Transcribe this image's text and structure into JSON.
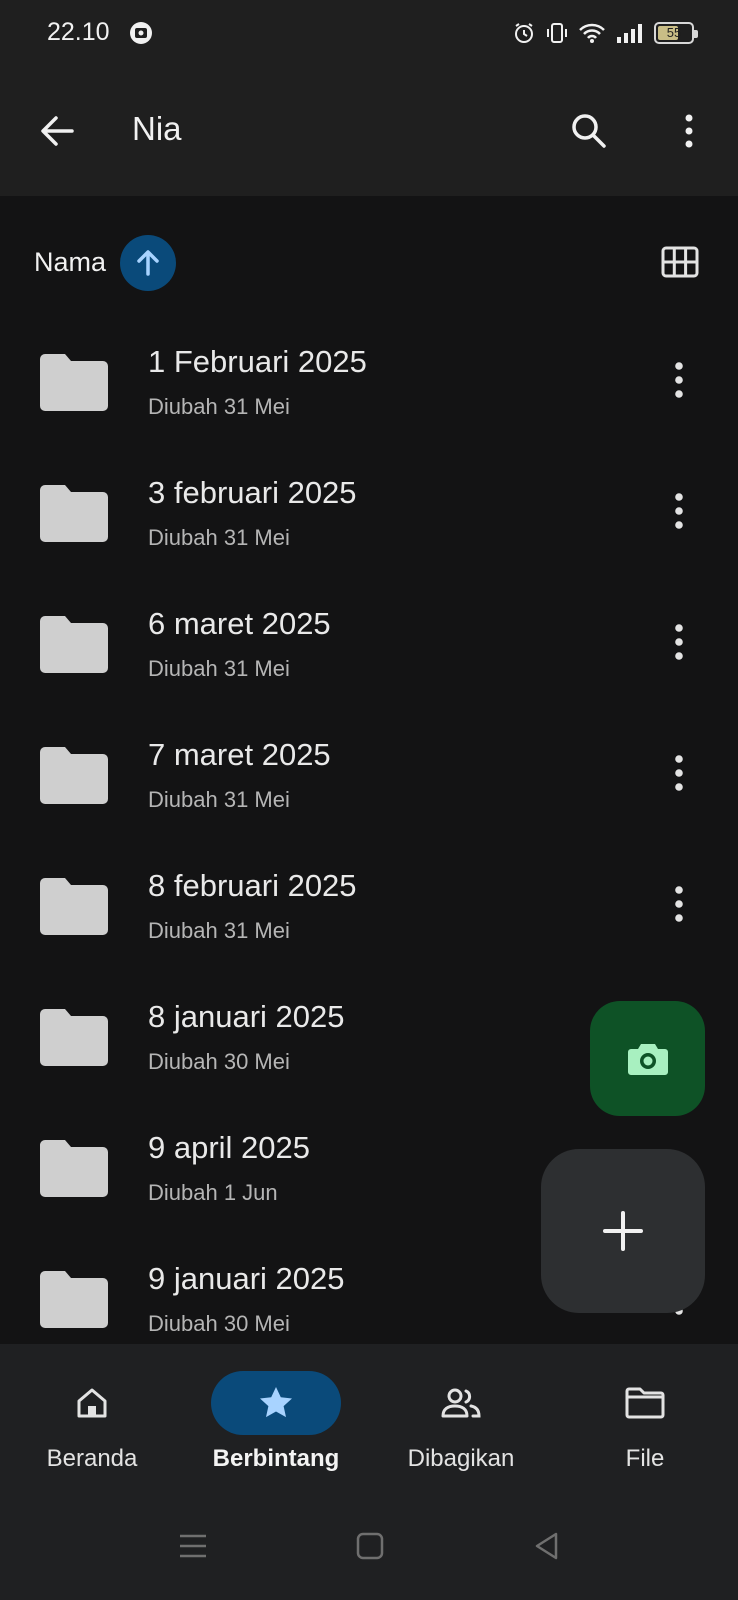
{
  "status_bar": {
    "time": "22.10",
    "battery_level": "55",
    "icons": [
      "app-notification-icon",
      "alarm-icon",
      "vibrate-icon",
      "wifi-icon",
      "signal-icon",
      "battery-icon"
    ]
  },
  "app_bar": {
    "title": "Nia",
    "icons": [
      "back-arrow-icon",
      "search-icon",
      "more-vert-icon"
    ]
  },
  "sort": {
    "label": "Nama",
    "direction": "ascending",
    "view_icon": "grid-view-icon"
  },
  "files": [
    {
      "name": "1 Februari 2025",
      "meta": "Diubah 31 Mei"
    },
    {
      "name": "3 februari 2025",
      "meta": "Diubah 31 Mei"
    },
    {
      "name": "6 maret 2025",
      "meta": "Diubah 31 Mei"
    },
    {
      "name": "7 maret 2025",
      "meta": "Diubah 31 Mei"
    },
    {
      "name": "8 februari 2025",
      "meta": "Diubah 31 Mei"
    },
    {
      "name": "8 januari 2025",
      "meta": "Diubah 30 Mei"
    },
    {
      "name": "9 april 2025",
      "meta": "Diubah 1 Jun"
    },
    {
      "name": "9 januari 2025",
      "meta": "Diubah 30 Mei"
    }
  ],
  "fab": {
    "camera_icon": "camera-icon",
    "add_icon": "plus-icon",
    "camera_color": "#0e5226"
  },
  "bottom_nav": {
    "items": [
      {
        "label": "Beranda",
        "icon": "home-icon",
        "active": false
      },
      {
        "label": "Berbintang",
        "icon": "star-icon",
        "active": true
      },
      {
        "label": "Dibagikan",
        "icon": "people-icon",
        "active": false
      },
      {
        "label": "File",
        "icon": "folder-outline-icon",
        "active": false
      }
    ]
  },
  "colors": {
    "background": "#131314",
    "surface": "#1f1f1f",
    "accent": "#0a4a7a",
    "accent_light": "#a8d3ff",
    "folder": "#cfcfcf"
  }
}
